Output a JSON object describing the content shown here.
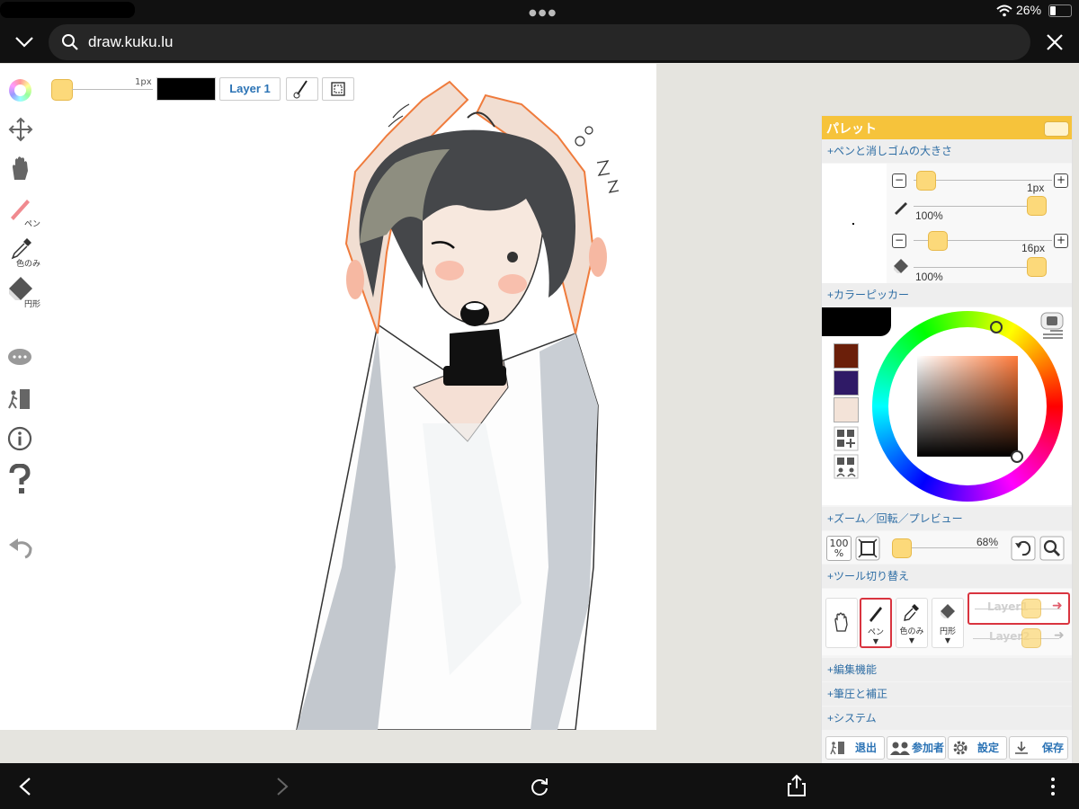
{
  "status": {
    "battery": "26%"
  },
  "browser": {
    "url": "draw.kuku.lu"
  },
  "top_toolbar": {
    "size_label": "1px",
    "layer_button": "Layer 1"
  },
  "left_tools": {
    "pen": "ペン",
    "eyedropper": "色のみ",
    "eraser": "円形"
  },
  "palette": {
    "title": "パレット",
    "sections": {
      "size": "+ペンと消しゴムの大きさ",
      "color": "+カラーピッカー",
      "zoom": "+ズーム／回転／プレビュー",
      "tool_switch": "+ツール切り替え",
      "edit": "+編集機能",
      "pressure": "+筆圧と補正",
      "system": "+システム"
    },
    "pen_size": "1px",
    "pen_opacity": "100%",
    "eraser_size": "16px",
    "eraser_opacity": "100%",
    "zoom_reset": "100",
    "zoom_unit": "%",
    "zoom_value": "68%",
    "tools": {
      "pen": "ペン",
      "eyedropper": "色のみ",
      "eraser": "円形"
    },
    "layers": [
      "Layer1",
      "Layer2"
    ],
    "bottom_buttons": {
      "exit": "退出",
      "participants": "参加者",
      "settings": "設定",
      "save": "保存"
    },
    "swatches": [
      "#6b1f0a",
      "#2f1a66",
      "#f3e3d8"
    ]
  },
  "colors": {
    "accent_yellow": "#f6c33b",
    "current_color": "#000000",
    "layer_highlight": "#d9343f"
  }
}
